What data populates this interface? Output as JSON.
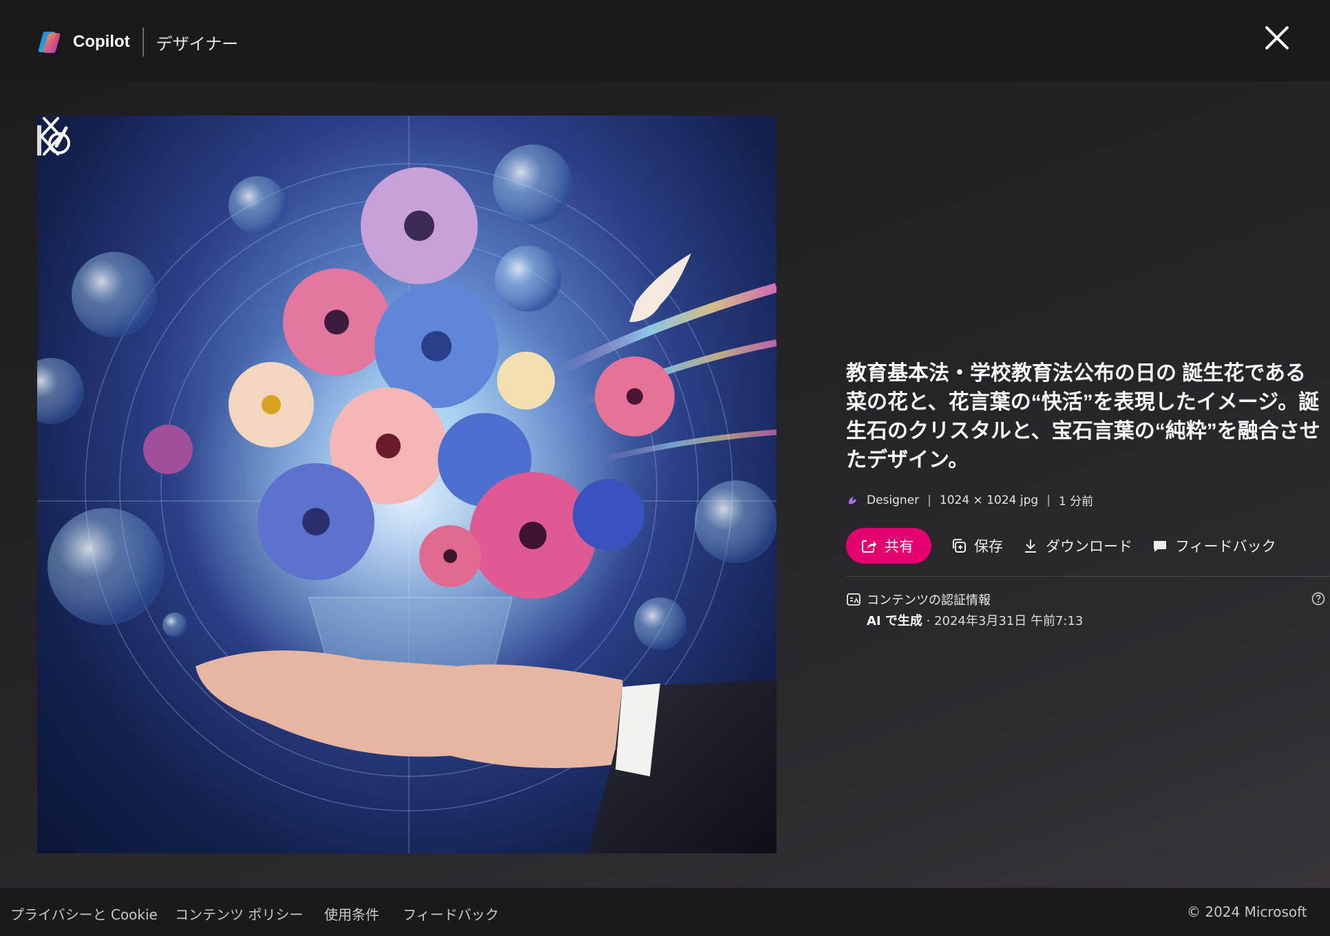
{
  "header": {
    "brand": "Copilot",
    "subtitle": "デザイナー",
    "logo_icon": "copilot-logo",
    "close_icon": "close-icon"
  },
  "image": {
    "alt": "教育基本法・学校教育法公布の日の 誕生花である菜の花と、花言葉の“快活”を表現したイメージ。誕生石のクリスタルと、宝石言葉の“純粋”を融合させたデザイン。",
    "prev_icon": "chevron-left-icon",
    "next_icon": "chevron-right-icon",
    "badge_icon": "designer-watermark-icon"
  },
  "info": {
    "title": "教育基本法・学校教育法公布の日の 誕生花である菜の花と、花言葉の“快活”を表現したイメージ。誕生石のクリスタルと、宝石言葉の“純粋”を融合させたデザイン。",
    "meta": {
      "source": "Designer",
      "dimensions": "1024 × 1024 jpg",
      "time": "1 分前"
    },
    "actions": {
      "share": "共有",
      "save": "保存",
      "download": "ダウンロード",
      "feedback": "フィードバック"
    },
    "credentials": {
      "label": "コンテンツの認証情報",
      "generated": "AI で生成",
      "date": " · 2024年3月31日 午前7:13"
    }
  },
  "footer": {
    "links": [
      "プライバシーと Cookie",
      "コンテンツ ポリシー",
      "使用条件",
      "フィードバック"
    ],
    "copyright": "© 2024 Microsoft"
  },
  "colors": {
    "accent": "#e5006f",
    "background": "#1c1b1c",
    "footer": "#1b1a1b"
  }
}
